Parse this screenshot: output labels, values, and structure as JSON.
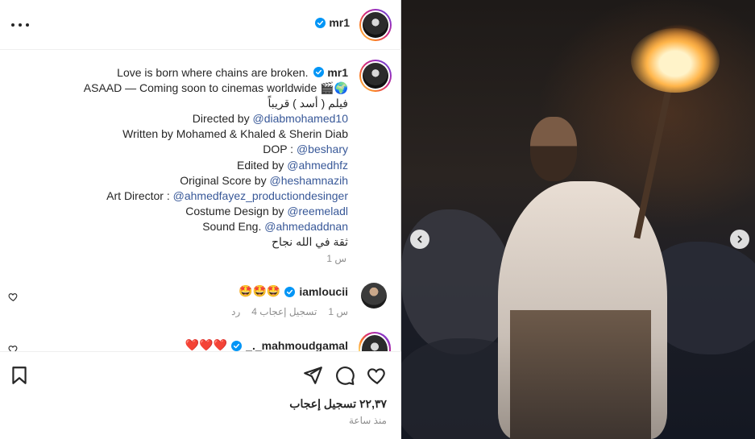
{
  "post": {
    "username": "mr1",
    "time": "1 س"
  },
  "caption": {
    "line1": "Love is born where chains are broken.",
    "line2": "ASAAD — Coming soon to cinemas worldwide 🎬🌍",
    "line3": "فيلم ( أسد ) قريباً",
    "directed_label": "Directed by",
    "directed_by": "@diabmohamed10",
    "written_line": "Written by Mohamed & Khaled & Sherin Diab",
    "dop_label": "DOP :",
    "dop": "@beshary",
    "edited_label": "Edited by",
    "edited_by": "@ahmedhfz",
    "score_label": "Original Score by",
    "score_by": "@heshamnazih",
    "art_label": "Art Director :",
    "art_by": "@ahmedfayez_productiondesinger",
    "costume_label": "Costume Design by",
    "costume_by": "@reemeladl",
    "sound_label": "Sound Eng.",
    "sound_by": "@ahmedaddnan",
    "closing": "ثقة في الله نجاح"
  },
  "comments": [
    {
      "username": "iamloucii",
      "text": "🤩🤩🤩",
      "time": "1 س",
      "likes": "4 تسجيل إعجاب",
      "reply": "رد"
    },
    {
      "username": "_._mahmoudgamal",
      "text": "❤️❤️❤️"
    }
  ],
  "actions": {
    "likes": "٢٢,٣٧ تسجيل إعجاب",
    "ago": "منذ ساعة"
  },
  "icons": {
    "more": "more-options-icon",
    "verified": "verified-badge-icon",
    "heart": "heart-icon",
    "comment": "comment-icon",
    "share": "share-icon",
    "save": "bookmark-icon",
    "prev": "chevron-left-icon",
    "next": "chevron-right-icon"
  },
  "colors": {
    "verified": "#0095f6",
    "link": "#385898",
    "muted": "#8e8e8e"
  }
}
